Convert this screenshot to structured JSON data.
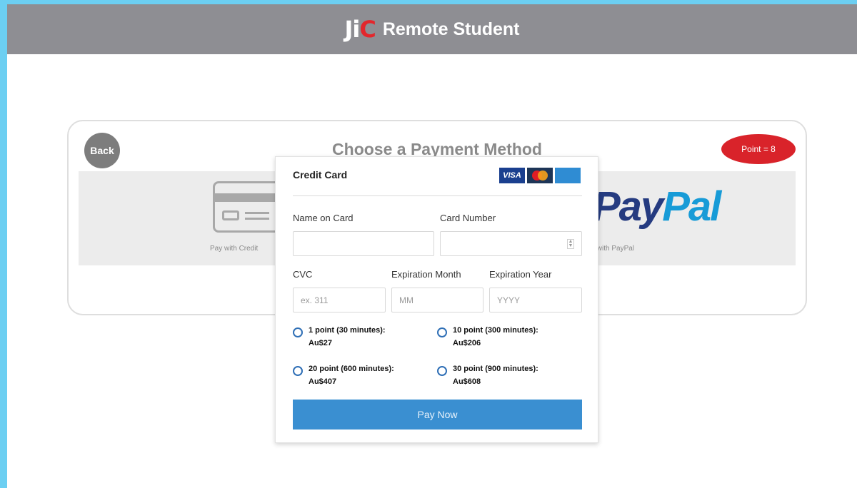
{
  "header": {
    "logo_prefix": "Ji",
    "logo_suffix": "C",
    "title": "Remote Student"
  },
  "payment_page": {
    "back_label": "Back",
    "title": "Choose a Payment Method",
    "point_badge": "Point = 8",
    "credit_option_label": "Pay with Credit",
    "paypal_logo_pay": "Pay",
    "paypal_logo_pal": "Pal",
    "paypal_option_label": "y with PayPal"
  },
  "modal": {
    "title": "Credit Card",
    "card_brands": [
      "VISA",
      "mastercard",
      "AMERICAN EXPRESS"
    ],
    "name_label": "Name on Card",
    "name_value": "",
    "card_number_label": "Card Number",
    "card_number_value": "",
    "cvc_label": "CVC",
    "cvc_placeholder": "ex. 311",
    "exp_month_label": "Expiration Month",
    "exp_month_placeholder": "MM",
    "exp_year_label": "Expiration Year",
    "exp_year_placeholder": "YYYY",
    "options": [
      {
        "line1": "1 point (30 minutes):",
        "line2": "Au$27",
        "selected": false
      },
      {
        "line1": "10 point (300 minutes):",
        "line2": "Au$206",
        "selected": false
      },
      {
        "line1": "20 point (600 minutes):",
        "line2": "Au$407",
        "selected": false
      },
      {
        "line1": "30 point (900 minutes):",
        "line2": "Au$608",
        "selected": false
      }
    ],
    "pay_button": "Pay Now"
  },
  "colors": {
    "header_bg": "#8e8e93",
    "accent": "#3a8fd1",
    "badge": "#d9232a",
    "frame": "#6ccff2"
  }
}
